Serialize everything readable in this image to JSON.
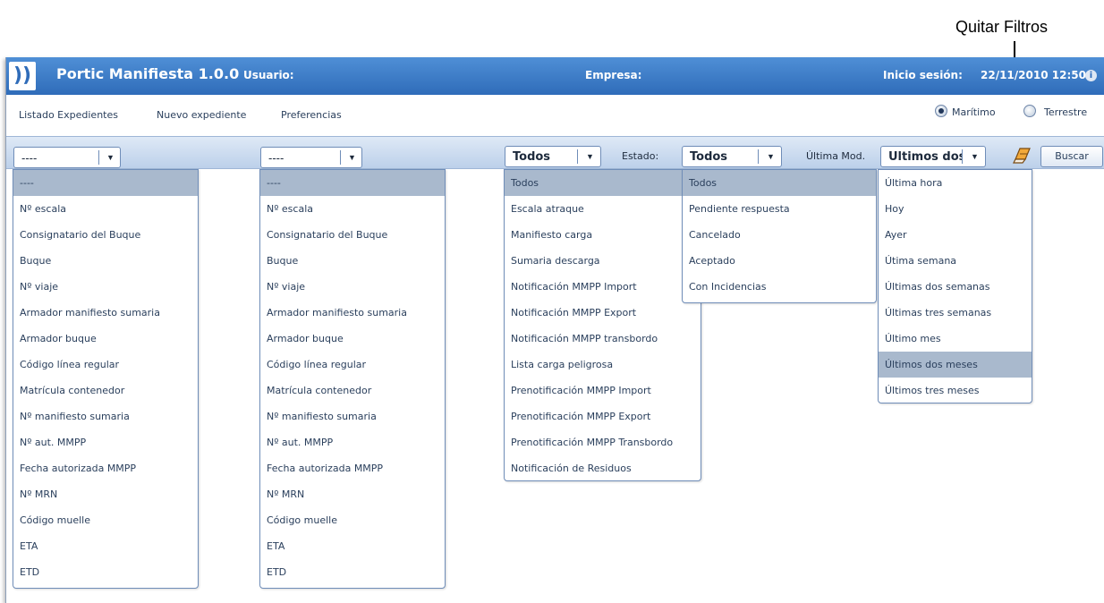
{
  "annotation": {
    "label": "Quitar Filtros"
  },
  "header": {
    "app_title": "Portic Manifiesta 1.0.0",
    "user_label": "Usuario:",
    "empresa_label": "Empresa:",
    "inicio_label": "Inicio sesión:",
    "inicio_value": "22/11/2010 12:50",
    "brand_color": "#3b7ccb"
  },
  "nav": {
    "listado": "Listado Expedientes",
    "nuevo": "Nuevo expediente",
    "preferencias": "Preferencias"
  },
  "transport": {
    "maritimo": "Marítimo",
    "terrestre": "Terrestre",
    "selected": "Marítimo"
  },
  "filters": {
    "field1_value": "----",
    "field2_value": "----",
    "tipo_value": "Todos",
    "estado_label": "Estado:",
    "estado_value": "Todos",
    "ultima_label": "Última Mod.",
    "ultima_value": "Últimos dos",
    "buscar": "Buscar"
  },
  "dropdowns": {
    "field_options": [
      "----",
      "Nº escala",
      "Consignatario del Buque",
      "Buque",
      "Nº viaje",
      "Armador manifiesto sumaria",
      "Armador buque",
      "Código línea regular",
      "Matrícula contenedor",
      "Nº manifiesto sumaria",
      "Nº aut. MMPP",
      "Fecha autorizada MMPP",
      "Nº MRN",
      "Código muelle",
      "ETA",
      "ETD"
    ],
    "tipo_options": [
      "Todos",
      "Escala atraque",
      "Manifiesto carga",
      "Sumaria descarga",
      "Notificación MMPP Import",
      "Notificación MMPP Export",
      "Notificación MMPP transbordo",
      "Lista carga peligrosa",
      "Prenotificación MMPP Import",
      "Prenotificación MMPP Export",
      "Prenotificación MMPP Transbordo",
      "Notificación de Residuos"
    ],
    "estado_options": [
      "Todos",
      "Pendiente respuesta",
      "Cancelado",
      "Aceptado",
      "Con Incidencias"
    ],
    "ultima_options": [
      "Última hora",
      "Hoy",
      "Ayer",
      "Útima semana",
      "Últimas dos semanas",
      "Últimas tres semanas",
      "Último mes",
      "Últimos dos meses",
      "Últimos tres meses"
    ],
    "selected": {
      "field1": 0,
      "field2": 0,
      "tipo": 0,
      "estado": 0,
      "ultima": 7
    }
  }
}
